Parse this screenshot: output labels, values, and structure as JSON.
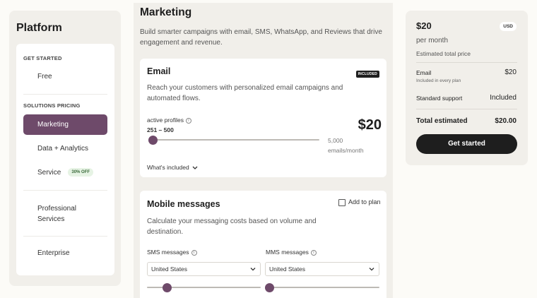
{
  "sidebar": {
    "title": "Platform",
    "get_started_label": "GET STARTED",
    "free": "Free",
    "solutions_label": "SOLUTIONS PRICING",
    "items": [
      {
        "label": "Marketing"
      },
      {
        "label": "Data + Analytics"
      },
      {
        "label": "Service",
        "badge": "30% OFF"
      },
      {
        "label": "Professional\nServices"
      },
      {
        "label": "Enterprise"
      }
    ]
  },
  "main": {
    "title": "Marketing",
    "description": "Build smarter campaigns with email, SMS, WhatsApp, and Reviews that drive engagement and revenue.",
    "email": {
      "title": "Email",
      "badge": "INCLUDED",
      "description": "Reach your customers with personalized email campaigns and automated flows.",
      "profiles_label": "active profiles",
      "profiles_value": "251 – 500",
      "price": "$20",
      "emails_count": "5,000",
      "emails_unit": "emails/month",
      "whats_included": "What's included",
      "slider_fraction": 0
    },
    "mobile": {
      "title": "Mobile messages",
      "add_to_plan": "Add to plan",
      "description": "Calculate your messaging costs based on volume and destination.",
      "sms_label": "SMS messages",
      "mms_label": "MMS messages",
      "sms_country": "United States",
      "mms_country": "United States",
      "sms_slider_fraction": 0.15,
      "mms_slider_fraction": 0
    }
  },
  "summary": {
    "price": "$20",
    "currency": "USD",
    "period": "per month",
    "estimated_label": "Estimated total price",
    "email_label": "Email",
    "email_note": "Included in every plan",
    "email_price": "$20",
    "support_label": "Standard support",
    "support_value": "Included",
    "total_label": "Total estimated",
    "total_value": "$20.00",
    "cta": "Get started"
  },
  "colors": {
    "accent": "#6e4a6a",
    "dark": "#1e1e1e",
    "panel": "#f1efea"
  }
}
